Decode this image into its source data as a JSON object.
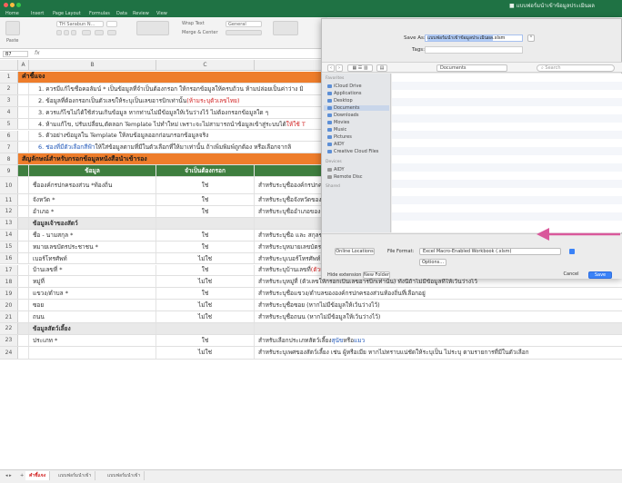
{
  "window": {
    "title": "■ แบบฟอร์มนำเข้าข้อมูลประเมินผล",
    "ribbon_tabs": [
      "Home",
      "Insert",
      "Page Layout",
      "Formulas",
      "Data",
      "Review",
      "View"
    ],
    "ribbon": {
      "paste": "Paste",
      "font": "TH Sarabun N...",
      "wrap_text": "Wrap Text",
      "merge_center": "Merge & Center",
      "general": "General"
    }
  },
  "formula_bar": {
    "name_box": "B7",
    "fx": "fx"
  },
  "columns": [
    "A",
    "B",
    "C",
    "D"
  ],
  "rows": [
    {
      "num": "1",
      "type": "orange",
      "a": "คำชี้แจง",
      "b": "",
      "c": ""
    },
    {
      "num": "2",
      "type": "note",
      "b": "1. ควรมีแก้ไขชื่อคอลัมน์ * เป็นข้อมูลที่จำเป็นต้องกรอก ให้กรอกข้อมูลให้ครบถ้วน ห้ามปล่อยเป็นค่าว่าง มิ",
      "b_red": ""
    },
    {
      "num": "3",
      "type": "note",
      "b": "2. ข้อมูลที่ต้องกรอกเป็นตัวเลขให้ระบุเป็นเลขอารบิกเท่านั้น",
      "b_red": "(ห้ามระบุตัวเลขไทย)"
    },
    {
      "num": "4",
      "type": "note",
      "b": "3. ควรแก้ไขไม่ได้ใช้ส่วนเกินข้อมูล หากท่านไม่มีข้อมูลให้เว้นว่างไว้ ไม่ต้องกรอกข้อมูลใด ๆ",
      "b_red": ""
    },
    {
      "num": "5",
      "type": "note",
      "b": "4. ห้ามแก้ไข, ปรับเปลี่ยน,ตัดลอก Template ไปทำใหม่ เพราะจะไม่สามารถนำข้อมูลเข้าสู่ระบบได้",
      "b_red": "ให้ใช้ T"
    },
    {
      "num": "6",
      "type": "note",
      "b": "5. ตัวอย่างข้อมูลใน Template ให้ลบข้อมูลออกก่อนกรอกข้อมูลจริง",
      "b_red": ""
    },
    {
      "num": "7",
      "type": "note-blue",
      "b_blue": "6. ช่องที่มีตัวเลือกสีฟ้า",
      "b": " ให้ใส่ข้อมูลตามที่มีในตัวเลือกที่ให้มาเท่านั้น ถ้าเพิ่มพิมพ์ถูกต้อง หรือเลือกจากลิ",
      "b_red": ""
    },
    {
      "num": "8",
      "type": "orange",
      "a": "สัญลักษณ์สำหรับกรอกข้อมูลหนังสือนำเข้ารอง",
      "b": "",
      "c": ""
    },
    {
      "num": "9",
      "type": "header",
      "b": "ข้อมูล",
      "c": "จำเป็นต้องกรอก",
      "d": "คำอธิบาย"
    },
    {
      "num": "10",
      "type": "data",
      "b": "ชื่อองค์กรปกครองส่วน *ท้องถิ่น",
      "c": "ใช่",
      "d": "สำหรับระบุชื่อองค์กรปกครองส่วนท้องถิ่น",
      "d_red": "ผล หลอดบ)"
    },
    {
      "num": "11",
      "type": "data",
      "b": "จังหวัด *",
      "c": "ใช่",
      "d": "สำหรับระบุชื่อจังหวัดของ",
      "d_red": ""
    },
    {
      "num": "12",
      "type": "data",
      "b": "อำเภอ *",
      "c": "ใช่",
      "d": "สำหรับระบุชื่ออำเภอของค์กรปกครองส่วนท้องถิ่น เช่น เมืองนครสวรรค์",
      "d_red": ""
    },
    {
      "num": "13",
      "type": "sub",
      "b": "ข้อมูลเจ้าของสัตว์",
      "c": "",
      "d": ""
    },
    {
      "num": "14",
      "type": "data",
      "b": "ชื่อ - นามสกุล *",
      "c": "ใช่",
      "d": "สำหรับระบุชื่อ และ สกุลของเจ้าของสัตว์",
      "d_red": ""
    },
    {
      "num": "15",
      "type": "data",
      "b": "หมายเลขบัตรประชาชน *",
      "c": "ใช่",
      "d": "สำหรับระบุหมายเลขบัตรประชาชน 13 หลัก",
      "d_red": "(กรอกเป็นเลขอารบิกเท่านั้น ไม่ต้องเว้นวรรค ไม่ต้องใส่ -)"
    },
    {
      "num": "16",
      "type": "data",
      "b": "เบอร์โทรศัพท์",
      "c": "ไม่ใช่",
      "d": "สำหรับระบุเบอร์โทรศัพท์ (กรอกเป็นเลขอารบิกเท่านั้น หากไม่มีข้อมูลให้เว้นว่างไว้)",
      "d_red": ""
    },
    {
      "num": "17",
      "type": "data",
      "b": "บ้านเลขที่ *",
      "c": "ใช่",
      "d": "สำหรับระบุบ้านเลขที่",
      "d_red": "(ตัวเลขให้กรอกเป็นเลขอารบิกเท่านั้น ไม่ / ได้)"
    },
    {
      "num": "18",
      "type": "data",
      "b": "หมู่ที่",
      "c": "ไม่ใช่",
      "d": "สำหรับระบุหมู่ที่ (ตัวเลขให้กรอกเป็นเลขอารบิกเท่านั้น) ทั้งนี้ถ้าไม่มีข้อมูลที่ให้เว้นว่างไว้",
      "d_red": ""
    },
    {
      "num": "19",
      "type": "data",
      "b": "แขวง/ตำบล *",
      "c": "ใช่",
      "d": "สำหรับระบุชื่อแขวง/ตำบลขององค์กรปกครองส่วนท้องถิ่นที่เลือกอยู่",
      "d_red": ""
    },
    {
      "num": "20",
      "type": "data",
      "b": "ซอย",
      "c": "ไม่ใช่",
      "d": "สำหรับระบุชื่อซอย (หากไม่มีข้อมูลให้เว้นว่างไว้)",
      "d_red": ""
    },
    {
      "num": "21",
      "type": "data",
      "b": "ถนน",
      "c": "ไม่ใช่",
      "d": "สำหรับระบุชื่อถนน (หากไม่มีข้อมูลให้เว้นว่างไว้)",
      "d_red": ""
    },
    {
      "num": "22",
      "type": "sub",
      "b": "ข้อมูลสัตว์เลี้ยง",
      "c": "",
      "d": ""
    },
    {
      "num": "23",
      "type": "data-pet",
      "b": "ประเภท *",
      "c": "ใช่",
      "d": "สำหรับเลือกประเภทสัตว์เลี้ยง",
      "d_blue": "สุนัข",
      "d_mid": " หรือ ",
      "d_blue2": "แมว"
    },
    {
      "num": "24",
      "type": "data",
      "b": "",
      "c": "ไม่ใช่",
      "d": "สำหรับระบุเพศของสัตว์เลี้ยง เช่น ผู้หรือเมีย หากไม่ทราบแน่ชัดให้ระบุเป็น ไม่ระบุ ตามรายการที่มีในตัวเลือก",
      "d_red": ""
    }
  ],
  "dialog": {
    "save_as_label": "Save As:",
    "save_as_value": "แบบฟอร์มนำเข้าข้อมูลประเมินผล",
    "save_as_ext": ".xlsm",
    "tags_label": "Tags:",
    "location": "Documents",
    "search_placeholder": "Search",
    "sidebar": {
      "favorites_label": "Favorites",
      "favorites": [
        "iCloud Drive",
        "Applications",
        "Desktop",
        "Documents",
        "Downloads",
        "Movies",
        "Music",
        "Pictures",
        "AIDY",
        "Creative Cloud Files"
      ],
      "devices_label": "Devices",
      "devices": [
        "AIDY",
        "Remote Disc"
      ],
      "shared_label": "Shared"
    },
    "online_locations": "Online Locations",
    "file_format_label": "File Format:",
    "file_format_value": "Excel Macro-Enabled Workbook (.xlsm)",
    "options": "Options...",
    "hide_extension": "Hide extension",
    "new_folder": "New Folder",
    "cancel": "Cancel",
    "save": "Save"
  },
  "sheet_tabs": [
    "คำชี้แจง",
    "แบบฟอร์มนำเข้า",
    "แบบฟอร์มนำเข้า"
  ],
  "colors": {
    "excel_green": "#1f7244",
    "orange": "#ee7d2b",
    "header_green": "#3e7e3f",
    "annotation_arrow": "#d9589b",
    "save_blue": "#3a82f7"
  }
}
